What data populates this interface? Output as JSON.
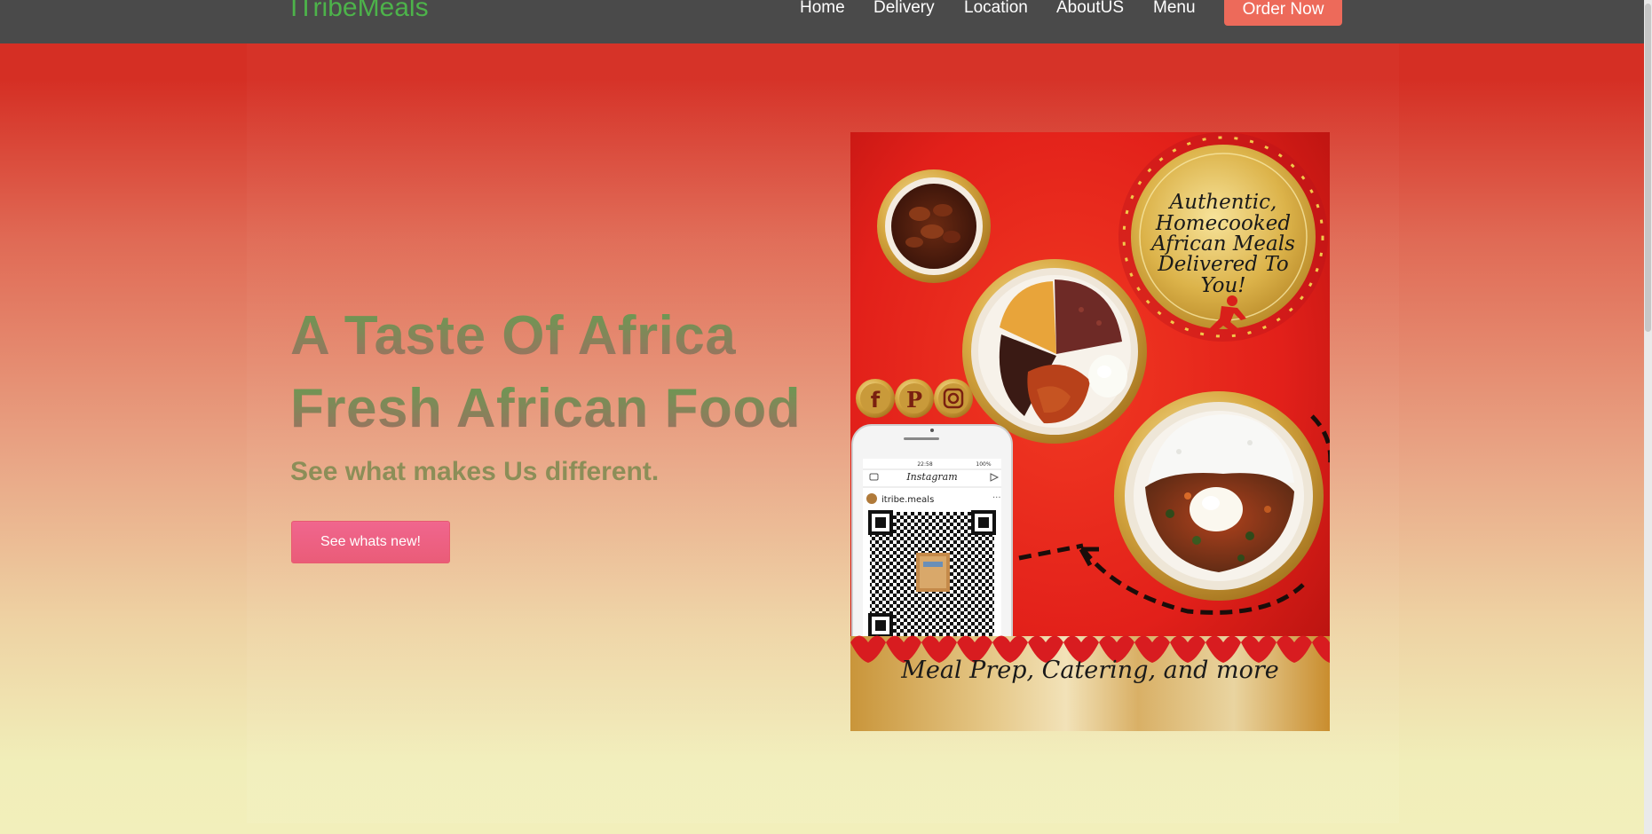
{
  "nav": {
    "brand": "ITribeMeals",
    "links": [
      "Home",
      "Delivery",
      "Location",
      "AboutUS",
      "Menu"
    ],
    "order_button": "Order Now"
  },
  "hero": {
    "headline_1": "A Taste Of Africa",
    "headline_2": "Fresh African Food",
    "subheadline": "See what makes Us different.",
    "cta_label": "See whats new!"
  },
  "poster": {
    "badge_lines": [
      "Authentic,",
      "Homecooked",
      "African Meals",
      "Delivered To",
      "You!"
    ],
    "footer_text": "Meal Prep, Catering, and more",
    "social_icons": [
      "facebook-icon",
      "pinterest-icon",
      "instagram-icon"
    ],
    "phone_app_title": "Instagram",
    "phone_time": "22:58",
    "phone_battery": "100%",
    "phone_account": "itribe.meals"
  },
  "colors": {
    "nav_bg": "#4a4a4a",
    "brand": "#4db34a",
    "order_button": "#ed6a5a",
    "cta": "#f0668e",
    "poster_red": "#e3221a",
    "gold": "#d4a53b"
  }
}
